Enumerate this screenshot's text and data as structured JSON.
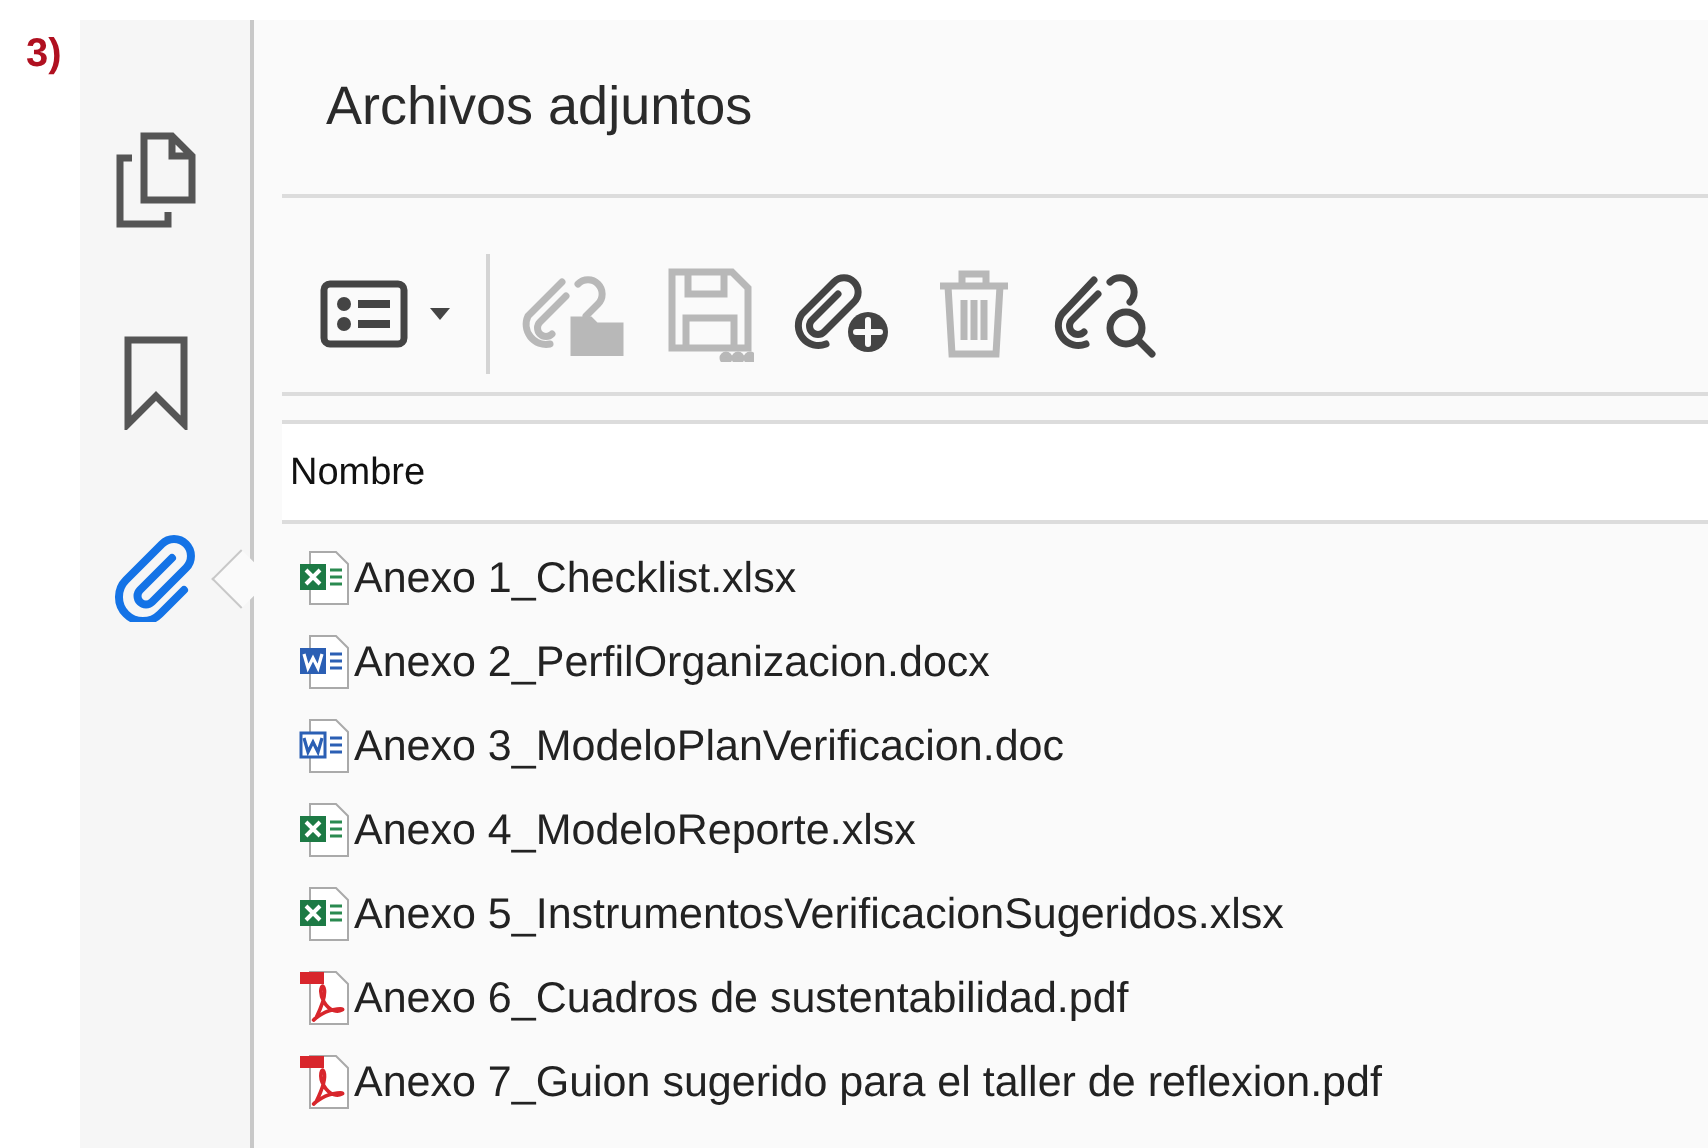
{
  "label": "3)",
  "sidebar": {
    "items": [
      {
        "kind": "pages",
        "selected": false
      },
      {
        "kind": "bookmarks",
        "selected": false
      },
      {
        "kind": "attachments",
        "selected": true
      }
    ]
  },
  "panel": {
    "title": "Archivos adjuntos",
    "toolbar": [
      {
        "kind": "view",
        "disabled": false
      },
      {
        "kind": "open",
        "disabled": true
      },
      {
        "kind": "save",
        "disabled": true
      },
      {
        "kind": "add",
        "disabled": false
      },
      {
        "kind": "delete",
        "disabled": true
      },
      {
        "kind": "search",
        "disabled": false
      }
    ],
    "column": "Nombre",
    "files": [
      {
        "kind": "xlsx",
        "name": "Anexo 1_Checklist.xlsx"
      },
      {
        "kind": "docx",
        "name": "Anexo 2_PerfilOrganizacion.docx"
      },
      {
        "kind": "doc",
        "name": "Anexo 3_ModeloPlanVerificacion.doc"
      },
      {
        "kind": "xlsx",
        "name": "Anexo 4_ModeloReporte.xlsx"
      },
      {
        "kind": "xlsx",
        "name": "Anexo 5_InstrumentosVerificacionSugeridos.xlsx"
      },
      {
        "kind": "pdf",
        "name": "Anexo 6_Cuadros de sustentabilidad.pdf"
      },
      {
        "kind": "pdf",
        "name": "Anexo 7_Guion sugerido para el taller de reflexion.pdf"
      }
    ]
  }
}
